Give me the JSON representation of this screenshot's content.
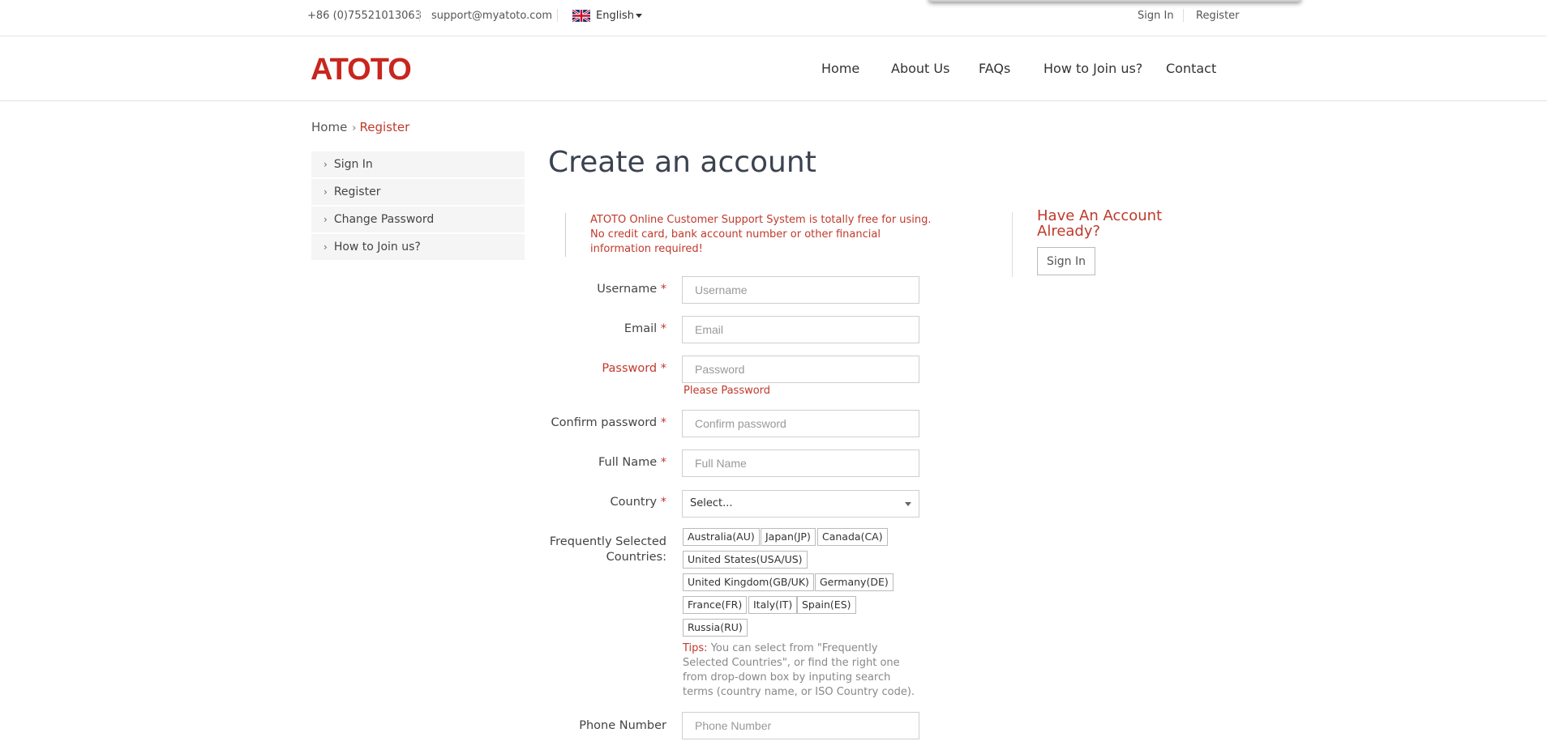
{
  "topbar": {
    "phone": "+86 (0)75521013063",
    "email": "support@myatoto.com",
    "language": "English",
    "signin": "Sign In",
    "register": "Register"
  },
  "header": {
    "logo": "ATOTO",
    "nav": [
      "Home",
      "About Us",
      "FAQs",
      "How to Join us?",
      "Contact"
    ]
  },
  "breadcrumb": {
    "home": "Home",
    "current": "Register"
  },
  "sidebar": {
    "items": [
      "Sign In",
      "Register",
      "Change Password",
      "How to Join us?"
    ]
  },
  "page_title": "Create an account",
  "notice": "ATOTO Online Customer Support System is totally free for using. No credit card, bank account number or other financial information required!",
  "form": {
    "username_label": "Username",
    "username_placeholder": "Username",
    "email_label": "Email",
    "email_placeholder": "Email",
    "password_label": "Password",
    "password_placeholder": "Password",
    "password_error": "Please Password",
    "confirm_label": "Confirm password",
    "confirm_placeholder": "Confirm password",
    "fullname_label": "Full Name",
    "fullname_placeholder": "Full Name",
    "country_label": "Country",
    "country_value": "Select...",
    "frequent_label_1": "Frequently Selected",
    "frequent_label_2": "Countries:",
    "countries": [
      "Australia(AU)",
      "Japan(JP)",
      "Canada(CA)",
      "United States(USA/US)",
      "United Kingdom(GB/UK)",
      "Germany(DE)",
      "France(FR)",
      "Italy(IT)",
      "Spain(ES)",
      "Russia(RU)"
    ],
    "tips_label": "Tips:",
    "tips_text": "You can select from \"Frequently Selected Countries\", or find the right one from drop-down box by inputing search terms (country name, or ISO Country code).",
    "phone_label": "Phone Number",
    "phone_placeholder": "Phone Number",
    "required_mark": "*"
  },
  "aside": {
    "title": "Have An Account Already?",
    "button": "Sign In"
  },
  "colors": {
    "brand": "#c8261e",
    "accent": "#c0392b"
  }
}
